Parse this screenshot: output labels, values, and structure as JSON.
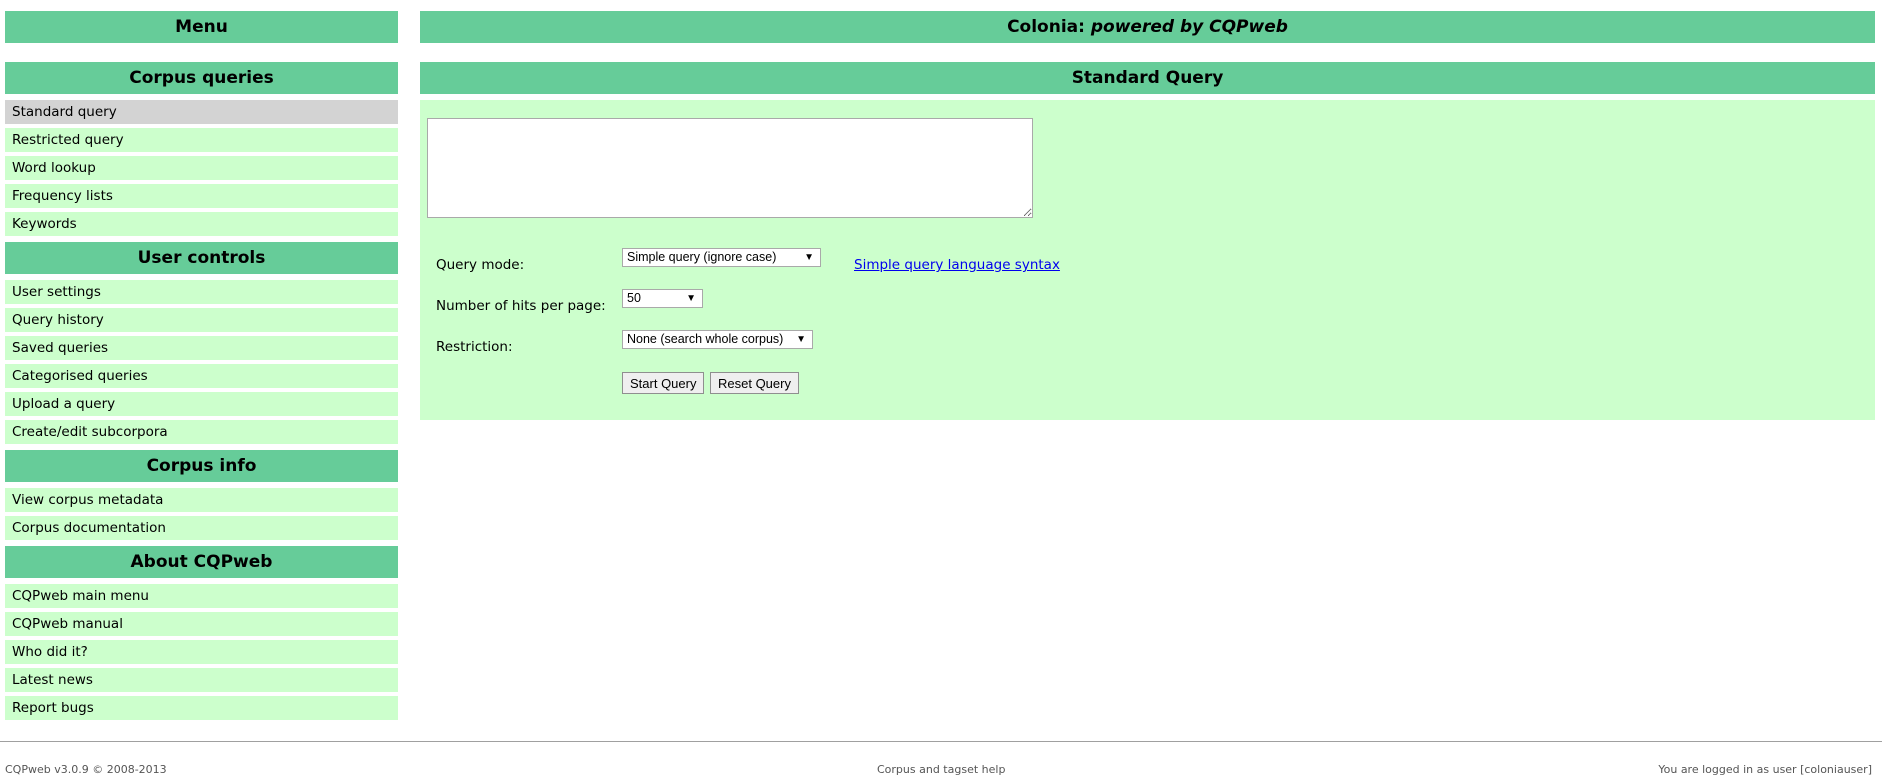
{
  "sidebar": {
    "menu_title": "Menu",
    "sections": [
      {
        "heading": "Corpus queries",
        "items": [
          "Standard query",
          "Restricted query",
          "Word lookup",
          "Frequency lists",
          "Keywords"
        ]
      },
      {
        "heading": "User controls",
        "items": [
          "User settings",
          "Query history",
          "Saved queries",
          "Categorised queries",
          "Upload a query",
          "Create/edit subcorpora"
        ]
      },
      {
        "heading": "Corpus info",
        "items": [
          "View corpus metadata",
          "Corpus documentation"
        ]
      },
      {
        "heading": "About CQPweb",
        "items": [
          "CQPweb main menu",
          "CQPweb manual",
          "Who did it?",
          "Latest news",
          "Report bugs"
        ]
      }
    ],
    "active_item": "Standard query"
  },
  "header": {
    "title_prefix": "Colonia: ",
    "title_powered": "powered by CQPweb"
  },
  "main": {
    "page_title": "Standard Query",
    "query_text": "",
    "query_mode_label": "Query mode:",
    "query_mode_value": "Simple query (ignore case)",
    "syntax_link": "Simple query language syntax",
    "hits_label": "Number of hits per page:",
    "hits_value": "50",
    "restriction_label": "Restriction:",
    "restriction_value": "None (search whole corpus)",
    "start_button": "Start Query",
    "reset_button": "Reset Query"
  },
  "footer": {
    "version": "CQPweb v3.0.9 © 2008-2013",
    "help_link": "Corpus and tagset help",
    "login_status": "You are logged in as user [coloniauser]"
  },
  "colors": {
    "header_green": "#66cc99",
    "item_green": "#ccffcc",
    "active_gray": "#d3d3d3",
    "link_blue": "#0000ee"
  }
}
